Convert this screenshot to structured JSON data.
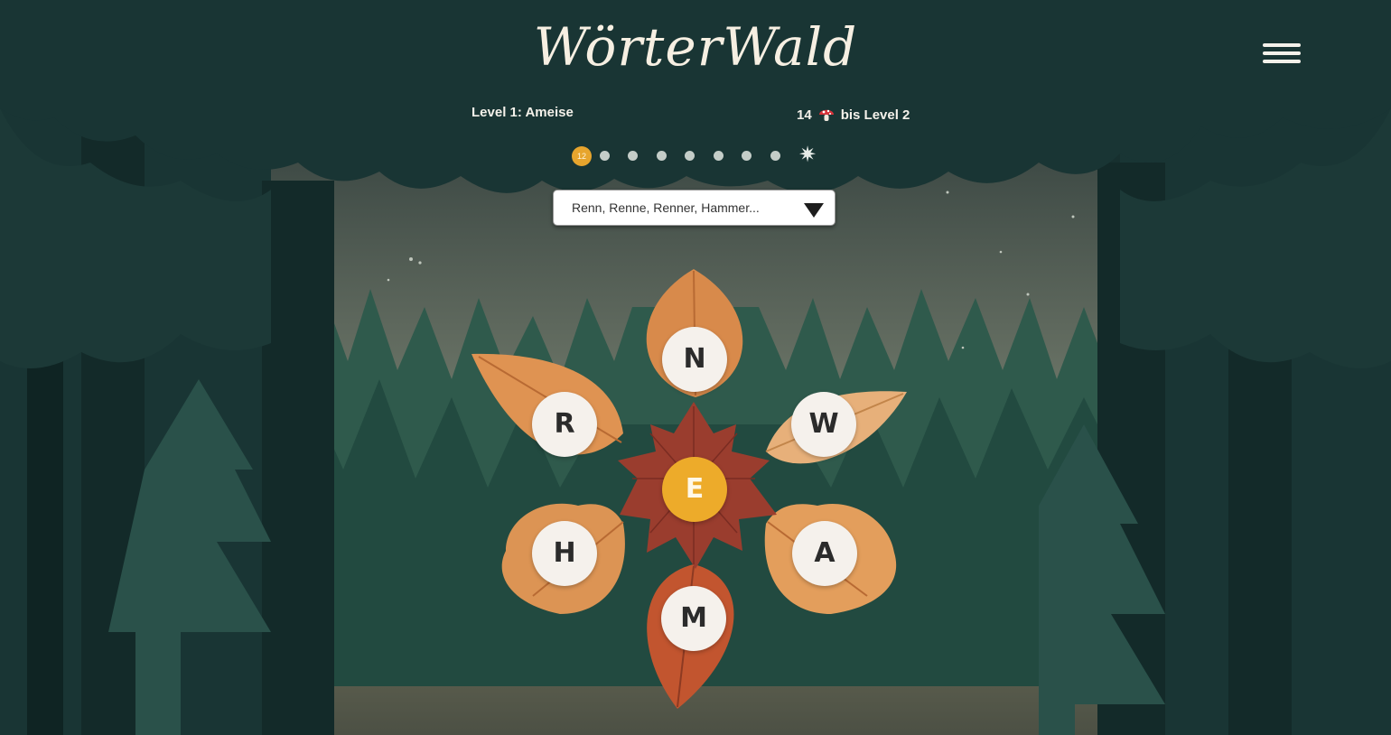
{
  "header": {
    "logo": "WörterWald",
    "level_label": "Level 1: Ameise",
    "progress_count": "14",
    "progress_suffix": "bis Level 2",
    "progress_icon": "mushroom-icon",
    "menu_icon": "hamburger-menu-icon"
  },
  "level_progress": {
    "current_count": "12",
    "dots_total": 8,
    "end_icon": "star-icon",
    "end_glyph": "✷"
  },
  "word_dropdown": {
    "selected": "Renn, Renne, Renner, Hammer..."
  },
  "letters": {
    "center": "E",
    "top": "N",
    "upper_left": "R",
    "upper_right": "W",
    "lower_left": "H",
    "lower_right": "A",
    "bottom": "M"
  },
  "colors": {
    "center_letter": "#edab2a",
    "current_dot": "#e7a52d",
    "forest_dark": "#17302f",
    "sky": "#6c7466"
  }
}
